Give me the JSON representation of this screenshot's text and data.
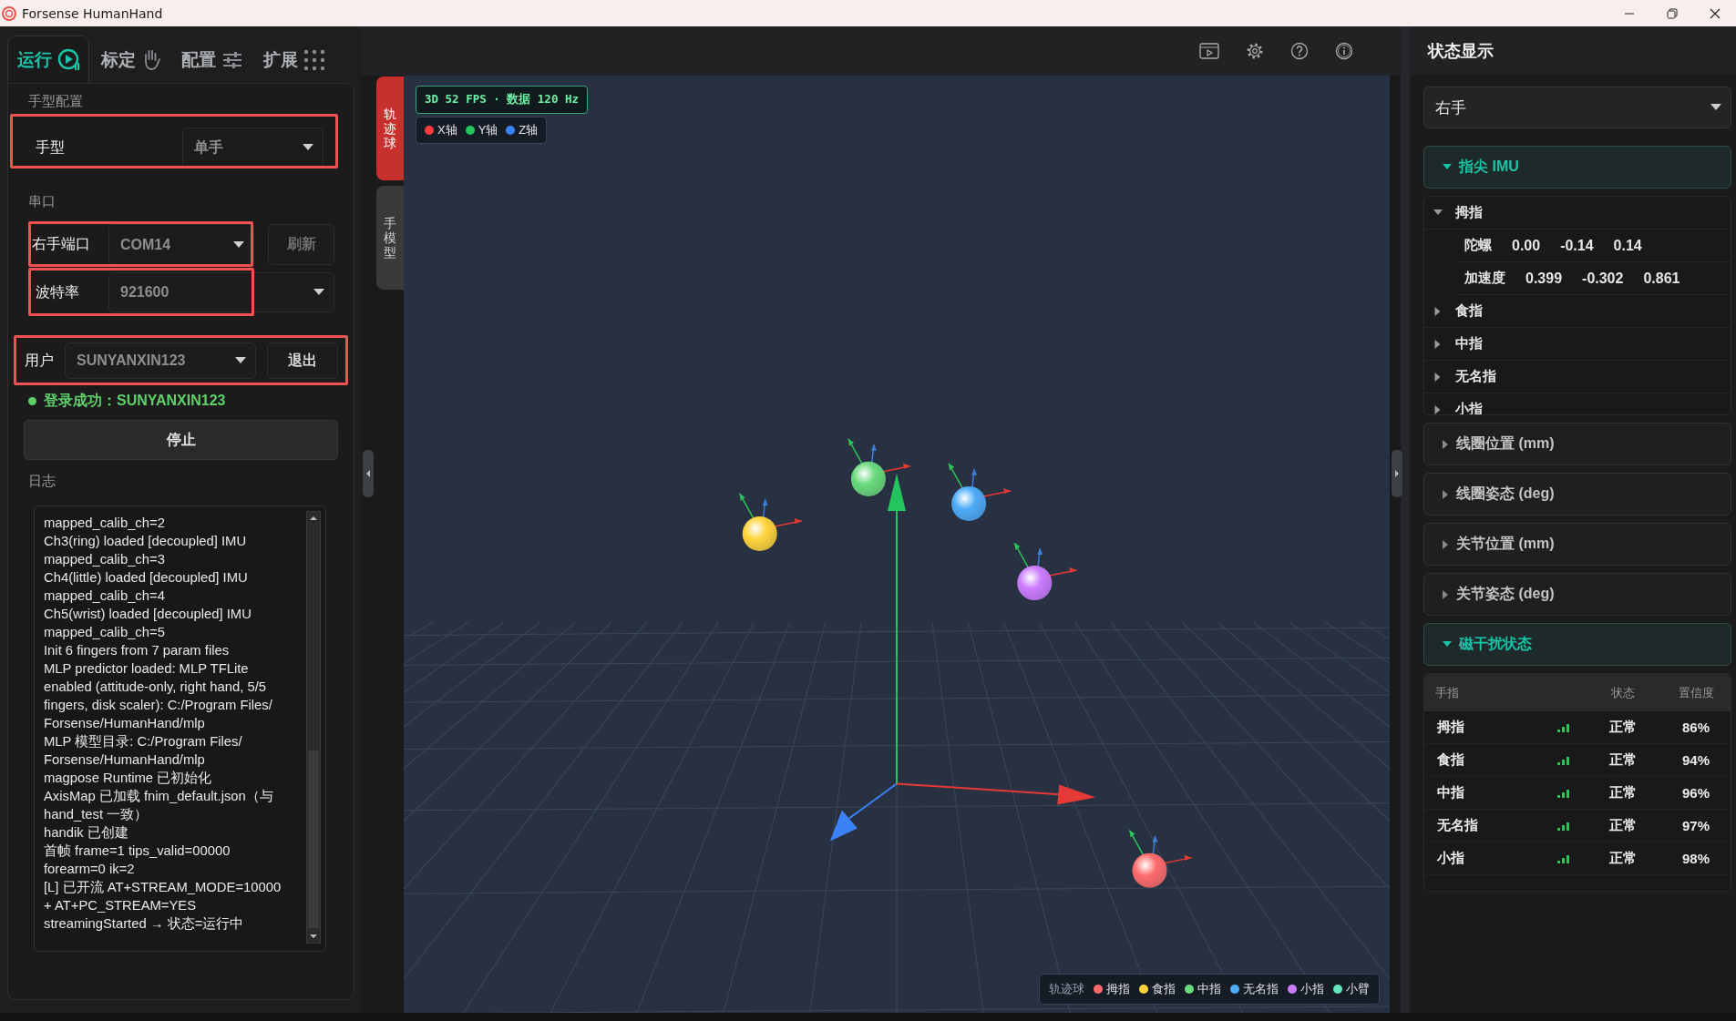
{
  "window": {
    "title": "Forsense HumanHand"
  },
  "left_tabs": [
    {
      "label": "运行",
      "selected": true
    },
    {
      "label": "标定",
      "selected": false
    },
    {
      "label": "配置",
      "selected": false
    },
    {
      "label": "扩展",
      "selected": false
    }
  ],
  "hand_config": {
    "heading": "手型配置",
    "field_label": "手型",
    "value": "单手"
  },
  "serial": {
    "heading": "串口",
    "port_label": "右手端口",
    "port_value": "COM14",
    "refresh_button": "刷新",
    "baud_label": "波特率",
    "baud_value": "921600"
  },
  "user": {
    "label": "用户",
    "value": "SUNYANXIN123",
    "logout_button": "退出",
    "login_status": "登录成功：SUNYANXIN123"
  },
  "stop_button": "停止",
  "log": {
    "heading": "日志",
    "lines": [
      "mapped_calib_ch=2",
      "Ch3(ring) loaded [decoupled] IMU",
      "mapped_calib_ch=3",
      "Ch4(little) loaded [decoupled] IMU",
      "mapped_calib_ch=4",
      "Ch5(wrist) loaded [decoupled] IMU",
      "mapped_calib_ch=5",
      "Init 6 fingers from 7 param files",
      "MLP predictor loaded: MLP TFLite",
      "enabled (attitude-only, right hand, 5/5",
      "fingers, disk scaler): C:/Program Files/",
      "Forsense/HumanHand/mlp",
      "MLP 模型目录: C:/Program Files/",
      "Forsense/HumanHand/mlp",
      "magpose Runtime 已初始化",
      "AxisMap 已加载 fnim_default.json（与",
      "hand_test 一致）",
      "handik 已创建",
      "首帧 frame=1 tips_valid=00000",
      "forearm=0 ik=2",
      "[L] 已开流 AT+STREAM_MODE=10000",
      "+ AT+PC_STREAM=YES",
      "streamingStarted → 状态=运行中"
    ]
  },
  "view_tabs": [
    {
      "label": "轨迹球",
      "selected": true
    },
    {
      "label": "手模型",
      "selected": false
    }
  ],
  "viewport": {
    "fps_badge": "3D 52 FPS · 数据 120 Hz",
    "axes": [
      {
        "label": "X轴",
        "color": "#ff3b3b"
      },
      {
        "label": "Y轴",
        "color": "#22c55e"
      },
      {
        "label": "Z轴",
        "color": "#3b82f6"
      }
    ],
    "legend": {
      "title": "轨迹球",
      "items": [
        {
          "label": "拇指",
          "color": "#ff6b6b"
        },
        {
          "label": "食指",
          "color": "#ffd43b"
        },
        {
          "label": "中指",
          "color": "#69db7c"
        },
        {
          "label": "无名指",
          "color": "#4dabf7"
        },
        {
          "label": "小指",
          "color": "#cc7cff"
        },
        {
          "label": "小臂",
          "color": "#63e6be"
        }
      ]
    }
  },
  "status_panel": {
    "title": "状态显示",
    "hand_select": "右手",
    "sections": [
      {
        "title": "指尖 IMU",
        "expanded": true,
        "fingers": [
          {
            "name": "拇指",
            "expanded": true,
            "readings": [
              {
                "label": "陀螺",
                "values": [
                  "0.00",
                  "-0.14",
                  "0.14"
                ]
              },
              {
                "label": "加速度",
                "values": [
                  "0.399",
                  "-0.302",
                  "0.861"
                ]
              }
            ]
          },
          {
            "name": "食指",
            "expanded": false
          },
          {
            "name": "中指",
            "expanded": false
          },
          {
            "name": "无名指",
            "expanded": false
          },
          {
            "name": "小指",
            "expanded": false
          }
        ]
      },
      {
        "title": "线圈位置 (mm)",
        "expanded": false
      },
      {
        "title": "线圈姿态 (deg)",
        "expanded": false
      },
      {
        "title": "关节位置 (mm)",
        "expanded": false
      },
      {
        "title": "关节姿态 (deg)",
        "expanded": false
      },
      {
        "title": "磁干扰状态",
        "expanded": true,
        "table": {
          "columns": [
            "手指",
            "状态",
            "置信度"
          ],
          "rows": [
            {
              "finger": "拇指",
              "status": "正常",
              "confidence": "86%"
            },
            {
              "finger": "食指",
              "status": "正常",
              "confidence": "94%"
            },
            {
              "finger": "中指",
              "status": "正常",
              "confidence": "96%"
            },
            {
              "finger": "无名指",
              "status": "正常",
              "confidence": "97%"
            },
            {
              "finger": "小指",
              "status": "正常",
              "confidence": "98%"
            }
          ]
        }
      }
    ]
  }
}
